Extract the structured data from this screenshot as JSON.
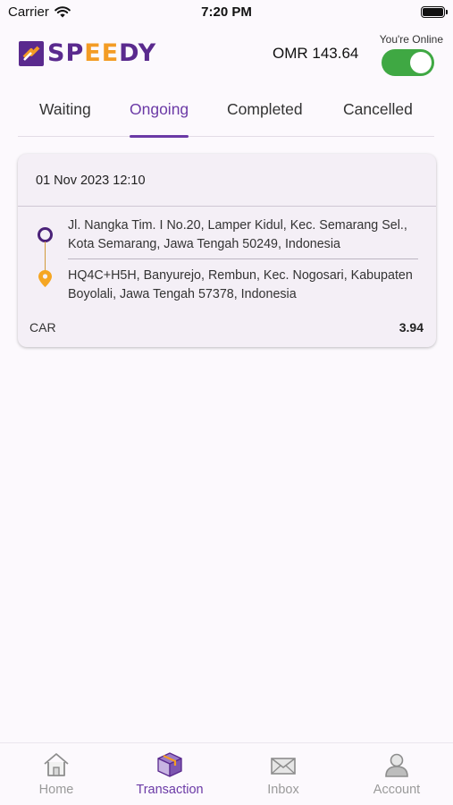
{
  "status_bar": {
    "carrier": "Carrier",
    "time": "7:20 PM"
  },
  "header": {
    "brand": "SPEEDY",
    "balance": "OMR 143.64",
    "online_label": "You're Online",
    "online": true
  },
  "tabs": [
    {
      "label": "Waiting",
      "active": false
    },
    {
      "label": "Ongoing",
      "active": true
    },
    {
      "label": "Completed",
      "active": false
    },
    {
      "label": "Cancelled",
      "active": false
    }
  ],
  "orders": [
    {
      "datetime": "01 Nov 2023 12:10",
      "pickup": "Jl. Nangka Tim. I No.20, Lamper Kidul, Kec. Semarang Sel., Kota Semarang, Jawa Tengah 50249, Indonesia",
      "dropoff": "HQ4C+H5H, Banyurejo, Rembun, Kec. Nogosari, Kabupaten Boyolali, Jawa Tengah 57378, Indonesia",
      "vehicle": "CAR",
      "distance": "3.94"
    }
  ],
  "bottom_nav": [
    {
      "label": "Home",
      "icon": "home-icon",
      "active": false
    },
    {
      "label": "Transaction",
      "icon": "box-icon",
      "active": true
    },
    {
      "label": "Inbox",
      "icon": "envelope-icon",
      "active": false
    },
    {
      "label": "Account",
      "icon": "user-icon",
      "active": false
    }
  ],
  "colors": {
    "brand_purple": "#6b3aa6",
    "brand_orange": "#f39c25",
    "online_green": "#3fa843",
    "background": "#fcf9fd",
    "card": "#f4eff6"
  }
}
